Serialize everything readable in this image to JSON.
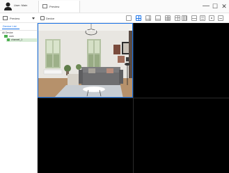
{
  "titlebar": {
    "user_name": "User: Main",
    "app_tab_label": "Preview",
    "minimize": "—",
    "maximize": "☐",
    "close": "✕"
  },
  "toolbar": {
    "preview_label": "Preview",
    "device_label": "Device"
  },
  "leftpanel": {
    "tab_label": "Device List",
    "tree": {
      "root": "All Device",
      "device": "cam",
      "channel": "channel_1"
    }
  },
  "colors": {
    "accent": "#1a73e8",
    "online": "#4caf50",
    "selected_row": "#d7ebd6"
  }
}
